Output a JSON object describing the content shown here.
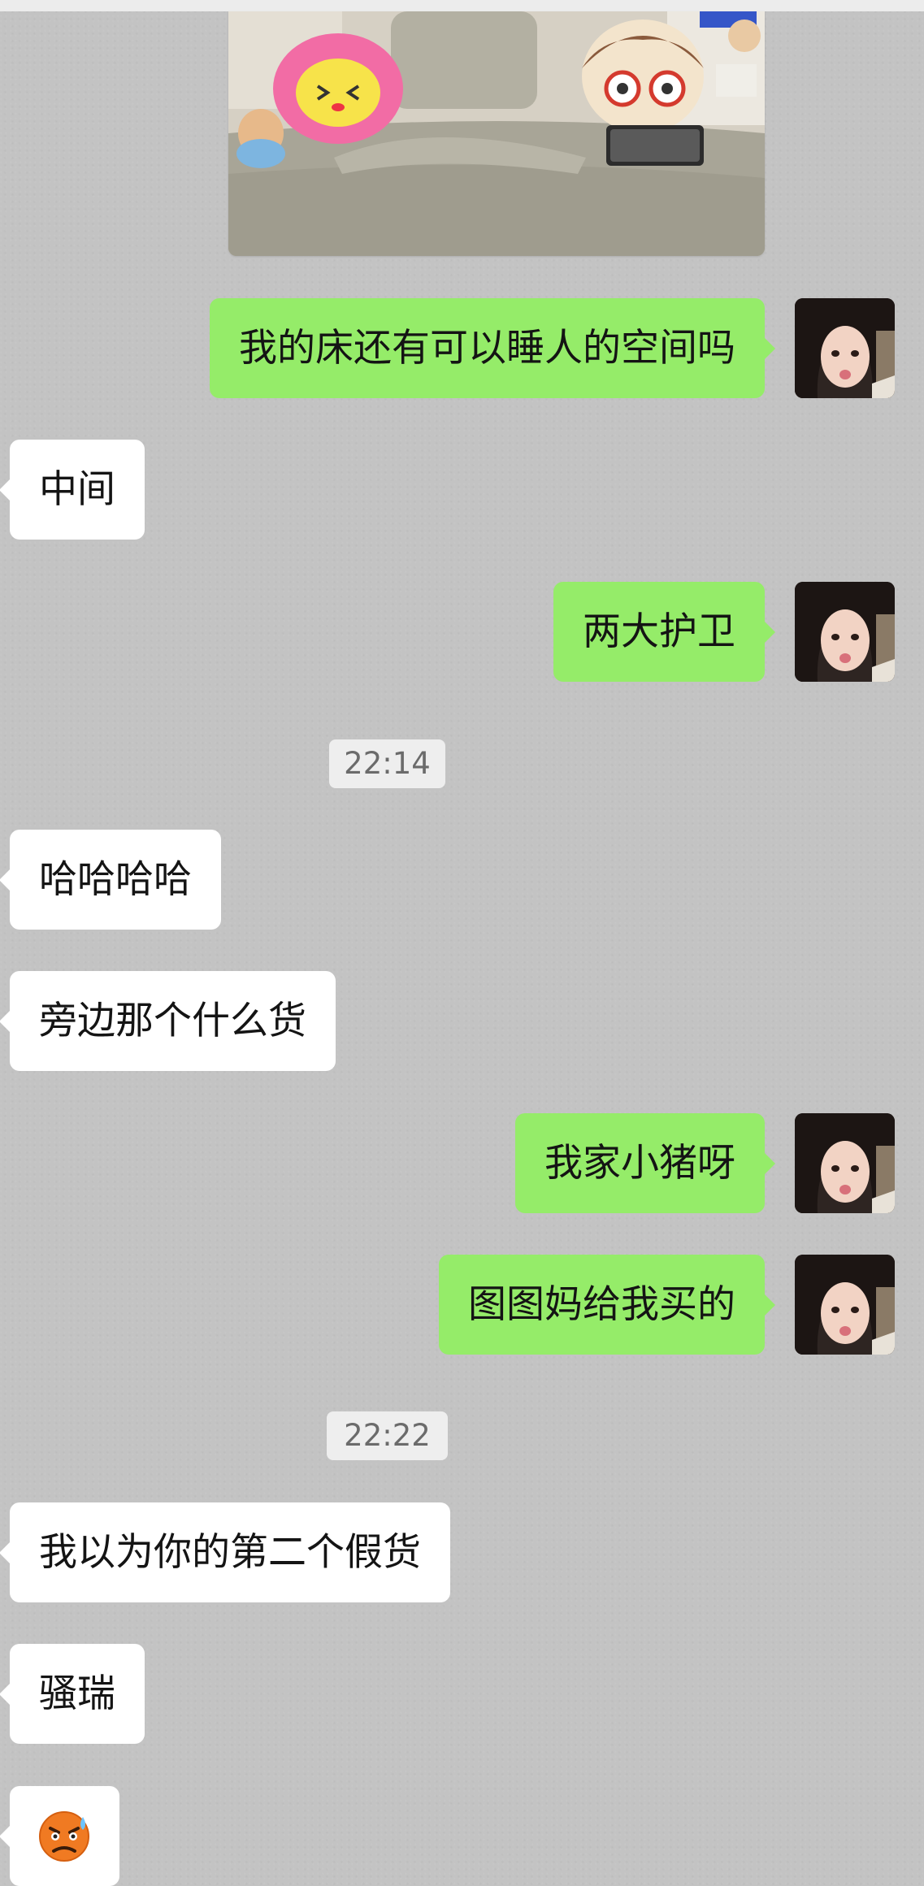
{
  "shared_image": {
    "description_icon": "bedroom-photo"
  },
  "messages": [
    {
      "side": "out",
      "text": "我的床还有可以睡人的空间吗"
    },
    {
      "side": "in",
      "text": "中间"
    },
    {
      "side": "out",
      "text": "两大护卫"
    },
    {
      "side": "time",
      "text": "22:14"
    },
    {
      "side": "in",
      "text": "哈哈哈哈"
    },
    {
      "side": "in",
      "text": "旁边那个什么货"
    },
    {
      "side": "out",
      "text": "我家小猪呀"
    },
    {
      "side": "out",
      "text": "图图妈给我买的"
    },
    {
      "side": "time",
      "text": "22:22"
    },
    {
      "side": "in",
      "text": "我以为你的第二个假货"
    },
    {
      "side": "in",
      "text": "骚瑞"
    },
    {
      "side": "in",
      "emoji": "sweating-angry-face-emoji"
    }
  ],
  "colors": {
    "background": "#c3c3c3",
    "outgoing_bubble": "#95ec69",
    "incoming_bubble": "#ffffff",
    "timestamp_bg": "#eeeeee"
  }
}
